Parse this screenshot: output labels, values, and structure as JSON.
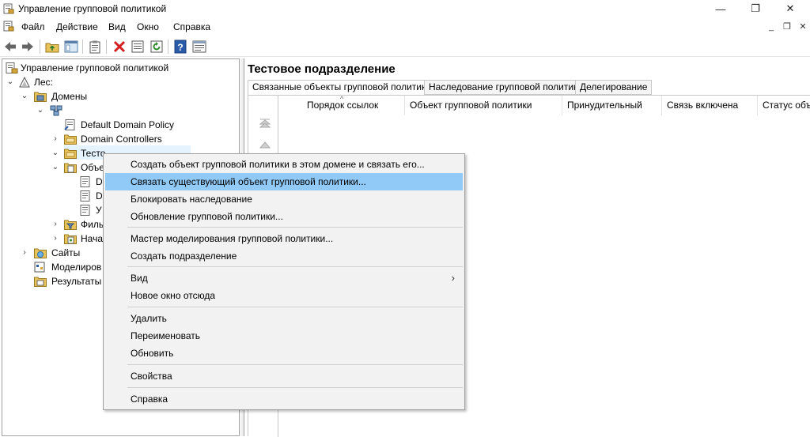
{
  "window": {
    "title": "Управление групповой политикой",
    "buttons": {
      "minimize": "—",
      "maximize": "❐",
      "close": "✕"
    }
  },
  "menubar": {
    "items": [
      "Файл",
      "Действие",
      "Вид",
      "Окно",
      "Справка"
    ],
    "mdi": {
      "minimize": "_",
      "restore": "❐",
      "close": "✕"
    }
  },
  "toolbar": {
    "icons": [
      "back-icon",
      "forward-icon",
      "up-folder-icon",
      "show-hide-tree-icon",
      "clipboard-icon",
      "delete-icon",
      "properties-icon",
      "refresh-icon",
      "help-icon",
      "console-view-icon"
    ]
  },
  "tree": {
    "items": [
      {
        "label": "Управление групповой политикой",
        "icon": "gpm-root-icon",
        "state": "none"
      },
      {
        "label": "Лес:",
        "icon": "forest-icon",
        "state": "expanded"
      },
      {
        "label": "Домены",
        "icon": "domains-folder-icon",
        "state": "expanded"
      },
      {
        "label": "",
        "icon": "domain-icon",
        "state": "expanded"
      },
      {
        "label": "Default Domain Policy",
        "icon": "gpo-link-icon",
        "state": "none"
      },
      {
        "label": "Domain Controllers",
        "icon": "ou-folder-icon",
        "state": "collapsed"
      },
      {
        "label": "Тесто",
        "icon": "ou-folder-icon",
        "state": "expanded"
      },
      {
        "label": "Объе",
        "icon": "gpo-container-icon",
        "state": "expanded"
      },
      {
        "label": "D",
        "icon": "gpo-icon",
        "state": "none"
      },
      {
        "label": "D",
        "icon": "gpo-icon",
        "state": "none"
      },
      {
        "label": "У",
        "icon": "gpo-icon",
        "state": "none"
      },
      {
        "label": "Филь",
        "icon": "wmi-filter-icon",
        "state": "collapsed"
      },
      {
        "label": "Нача",
        "icon": "starter-gpo-icon",
        "state": "collapsed"
      },
      {
        "label": "Сайты",
        "icon": "sites-icon",
        "state": "collapsed"
      },
      {
        "label": "Моделиров",
        "icon": "modeling-icon",
        "state": "none"
      },
      {
        "label": "Результаты",
        "icon": "results-icon",
        "state": "none"
      }
    ]
  },
  "right_pane": {
    "title": "Тестовое подразделение",
    "tabs": [
      "Связанные объекты групповой политики",
      "Наследование групповой политики",
      "Делегирование"
    ],
    "active_tab": 0,
    "columns": [
      "Порядок ссылок",
      "Объект групповой политики",
      "Принудительный",
      "Связь включена",
      "Статус объ"
    ]
  },
  "context_menu": {
    "items": [
      "Создать объект групповой политики в этом домене и связать его...",
      "Связать существующий объект групповой политики...",
      "Блокировать наследование",
      "Обновление групповой политики...",
      "Мастер моделирования групповой политики...",
      "Создать подразделение",
      "Вид",
      "Новое окно отсюда",
      "Удалить",
      "Переименовать",
      "Обновить",
      "Свойства",
      "Справка"
    ],
    "highlighted_index": 1,
    "submenu_arrow": "›"
  },
  "colors": {
    "menu_highlight": "#91c9f7",
    "tree_selection": "#e5f3ff",
    "menu_background": "#f2f2f2"
  }
}
